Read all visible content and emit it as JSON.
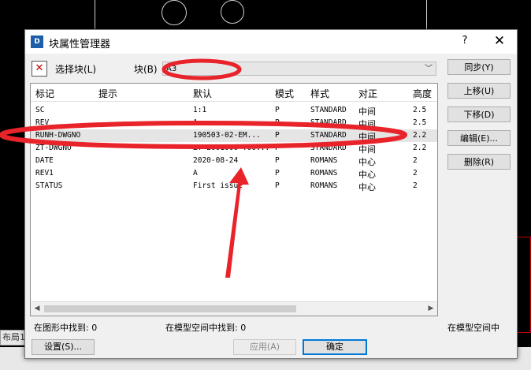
{
  "background": {
    "layout_tab": "布局1"
  },
  "dialog": {
    "title": "块属性管理器",
    "help": "?",
    "close": "✕",
    "select_block_label": "选择块(L)",
    "block_label": "块(B)",
    "block_value": "A3",
    "columns": [
      "标记",
      "提示",
      "默认",
      "模式",
      "样式",
      "对正",
      "高度"
    ],
    "rows": [
      {
        "tag": "SC",
        "prompt": "",
        "default": "1:1",
        "mode": "P",
        "style": "STANDARD",
        "just": "中间",
        "height": "2.5"
      },
      {
        "tag": "REV",
        "prompt": "",
        "default": "A",
        "mode": "P",
        "style": "STANDARD",
        "just": "中间",
        "height": "2.5"
      },
      {
        "tag": "RUNH-DWGNO",
        "prompt": "",
        "default": "190503-02-EM...",
        "mode": "P",
        "style": "STANDARD",
        "just": "中间",
        "height": "2.2"
      },
      {
        "tag": "ZT-DWGNO",
        "prompt": "",
        "default": "ZT-E001000-T00...",
        "mode": "P",
        "style": "STANDARD",
        "just": "中间",
        "height": "2.2"
      },
      {
        "tag": "DATE",
        "prompt": "",
        "default": "2020-08-24",
        "mode": "P",
        "style": "ROMANS",
        "just": "中心",
        "height": "2"
      },
      {
        "tag": "REV1",
        "prompt": "",
        "default": "A",
        "mode": "P",
        "style": "ROMANS",
        "just": "中心",
        "height": "2"
      },
      {
        "tag": "STATUS",
        "prompt": "",
        "default": "First issue",
        "mode": "P",
        "style": "ROMANS",
        "just": "中心",
        "height": "2"
      }
    ],
    "side_buttons": [
      "同步(Y)",
      "上移(U)",
      "下移(D)",
      "编辑(E)...",
      "删除(R)"
    ],
    "status_left": "在图形中找到: 0",
    "status_mid": "在模型空间中找到: 0",
    "status_right": "在模型空间中",
    "settings_button": "设置(S)...",
    "apply_button": "应用(A)",
    "ok_button": "确定"
  },
  "colors": {
    "annotation": "#e8232a",
    "accent": "#0078d7"
  }
}
